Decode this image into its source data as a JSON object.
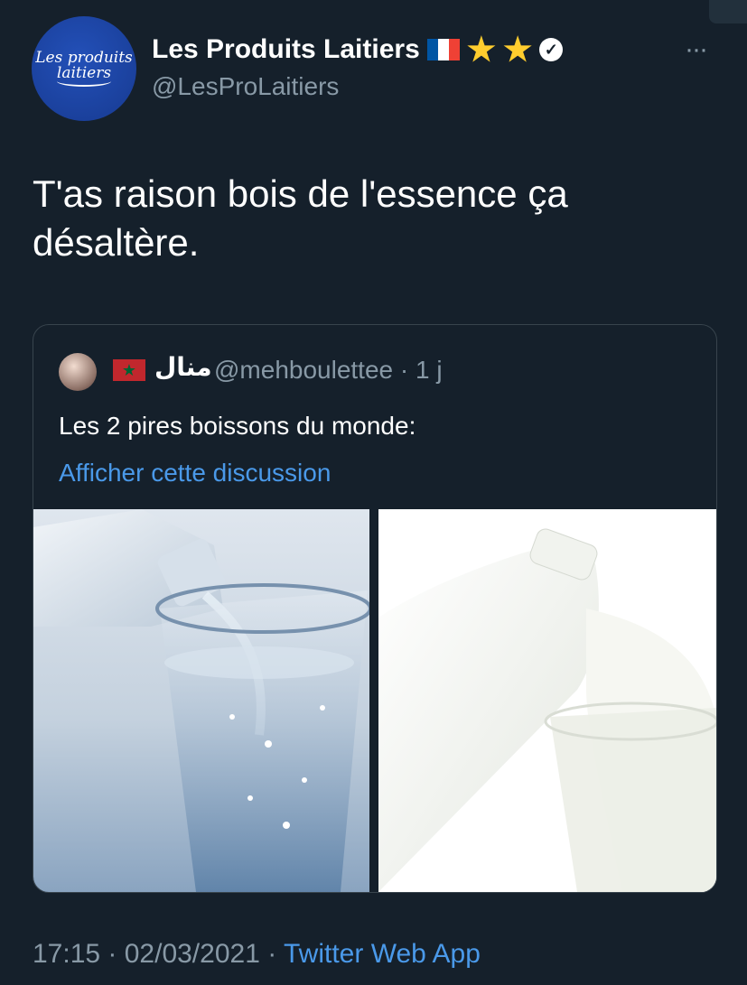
{
  "account": {
    "avatar_text_line1": "Les produits",
    "avatar_text_line2": "laitiers",
    "name": "Les Produits Laitiers",
    "handle": "@LesProLaitiers",
    "more_label": "···"
  },
  "tweet": {
    "text": "T'as raison bois de l'essence ça désaltère."
  },
  "quote": {
    "name": "منال",
    "handle_time": "@mehboulettee · 1 j",
    "text": "Les 2 pires boissons du monde:",
    "show_thread": "Afficher cette discussion",
    "images": [
      "water-glass-image",
      "milk-pour-image"
    ]
  },
  "footer": {
    "time_date": "17:15 · 02/03/2021 ·",
    "source": "Twitter Web App"
  },
  "colors": {
    "background": "#15202b",
    "secondary_text": "#8899a6",
    "link": "#4a99e9",
    "border": "#38444d"
  },
  "icons": [
    "france-flag-icon",
    "star-icon",
    "star-icon",
    "verified-icon",
    "more-icon",
    "morocco-flag-icon"
  ]
}
